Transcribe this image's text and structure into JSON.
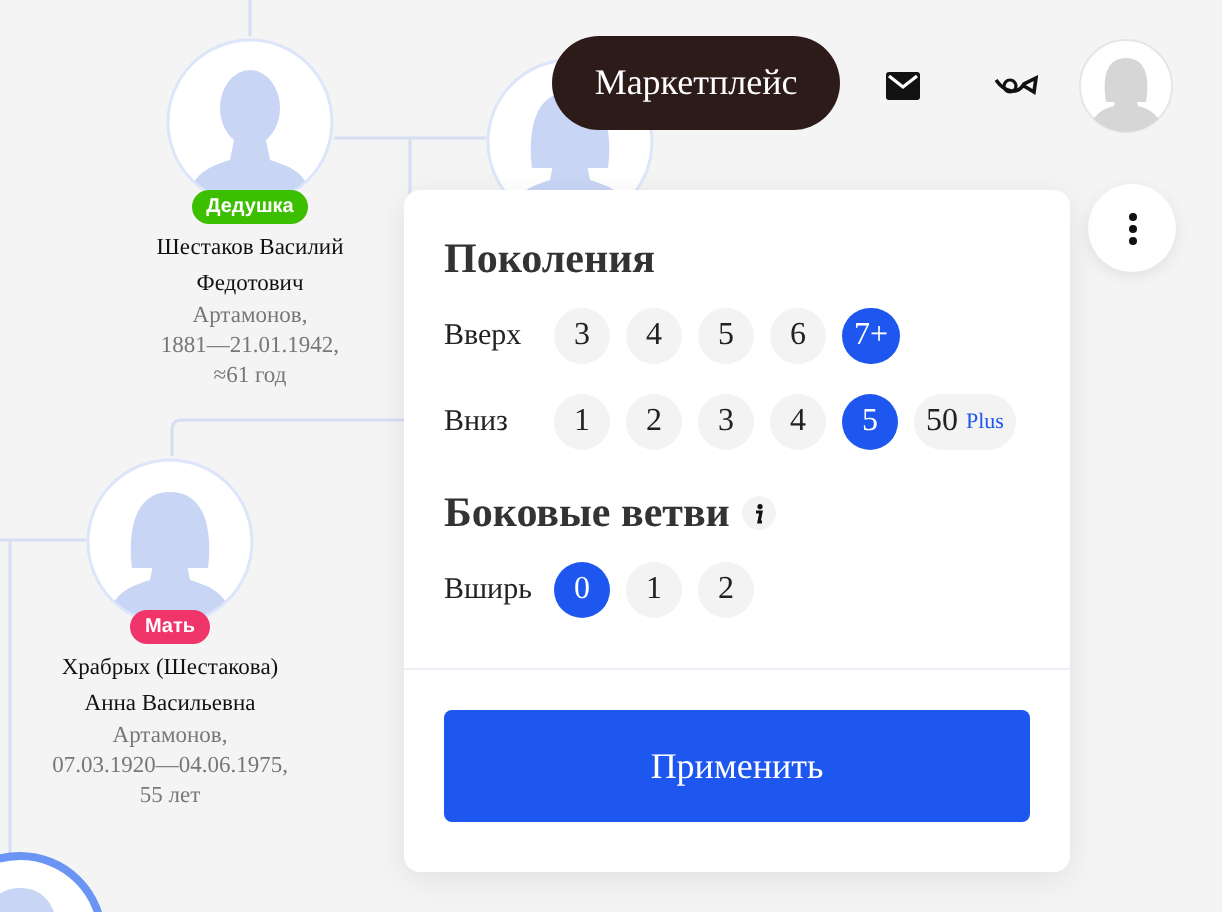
{
  "header": {
    "marketplace": "Маркетплейс"
  },
  "tree": {
    "people": [
      {
        "kind": "male",
        "badge": {
          "label": "Дедушка",
          "color": "#3cbf00"
        },
        "name": [
          "Шестаков Василий",
          "Федотович"
        ],
        "details": [
          "Артамонов,",
          "1881—21.01.1942,",
          "≈61 год"
        ]
      },
      {
        "kind": "female"
      },
      {
        "kind": "female",
        "badge": {
          "label": "Мать",
          "color": "#f0356b"
        },
        "name": [
          "Храбрых (Шестакова)",
          "Анна Васильевна"
        ],
        "details": [
          "Артамонов,",
          "07.03.1920—04.06.1975,",
          "55 лет"
        ]
      },
      {
        "kind": "current"
      }
    ]
  },
  "popup": {
    "sections": [
      {
        "title": "Поколения",
        "info": false,
        "rows": [
          {
            "label": "Вверх",
            "options": [
              {
                "label": "3",
                "selected": false
              },
              {
                "label": "4",
                "selected": false
              },
              {
                "label": "5",
                "selected": false
              },
              {
                "label": "6",
                "selected": false
              },
              {
                "label": "7+",
                "selected": true
              }
            ]
          },
          {
            "label": "Вниз",
            "options": [
              {
                "label": "1",
                "selected": false
              },
              {
                "label": "2",
                "selected": false
              },
              {
                "label": "3",
                "selected": false
              },
              {
                "label": "4",
                "selected": false
              },
              {
                "label": "5",
                "selected": true
              },
              {
                "label": "50",
                "tag": "Plus",
                "selected": false
              }
            ]
          }
        ]
      },
      {
        "title": "Боковые ветви",
        "info": true,
        "rows": [
          {
            "label": "Вширь",
            "options": [
              {
                "label": "0",
                "selected": true
              },
              {
                "label": "1",
                "selected": false
              },
              {
                "label": "2",
                "selected": false
              }
            ]
          }
        ]
      }
    ],
    "apply": "Применить"
  }
}
